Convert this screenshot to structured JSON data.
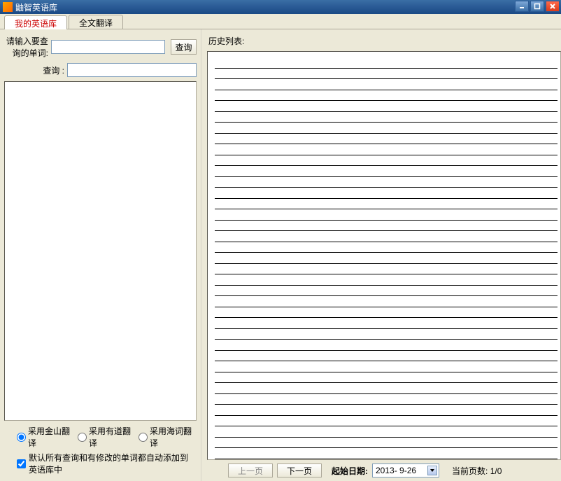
{
  "window": {
    "title": "鼬智英语库"
  },
  "tabs": {
    "tab1": "我的英语库",
    "tab2": "全文翻译"
  },
  "left": {
    "inputLabel": "请输入要查询的单词:",
    "searchBtn": "查询",
    "resultLabel": "查询 :",
    "radios": {
      "jin": "采用金山翻译",
      "youdao": "采用有道翻译",
      "haici": "采用海词翻译"
    },
    "checkbox": "默认所有查询和有修改的单词都自动添加到英语库中"
  },
  "right": {
    "historyLabel": "历史列表:",
    "prevBtn": "上一页",
    "nextBtn": "下一页",
    "dateLabel": "起始日期:",
    "dateValue": "2013- 9-26",
    "pageLabel": "当前页数:",
    "pageValue": "1/0"
  }
}
